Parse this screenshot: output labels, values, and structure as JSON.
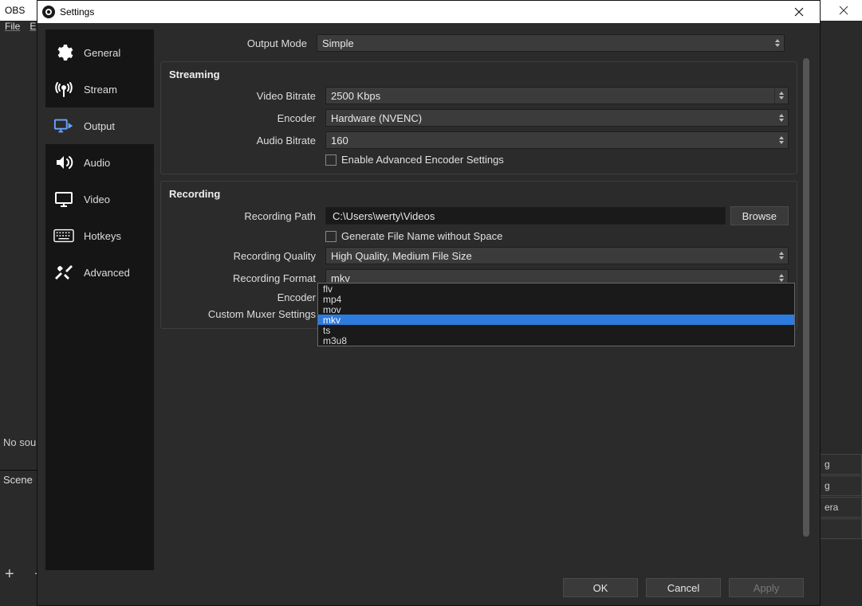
{
  "bg": {
    "title": "OBS",
    "menu": {
      "file": "File",
      "edit": "E"
    },
    "no_sources": "No sourc",
    "scene": "Scene",
    "plusminus": "+  −",
    "rt_rows": [
      "g",
      "g",
      "era",
      ""
    ]
  },
  "dialog": {
    "title": "Settings",
    "sidebar": [
      {
        "key": "general",
        "label": "General"
      },
      {
        "key": "stream",
        "label": "Stream"
      },
      {
        "key": "output",
        "label": "Output",
        "selected": true
      },
      {
        "key": "audio",
        "label": "Audio"
      },
      {
        "key": "video",
        "label": "Video"
      },
      {
        "key": "hotkeys",
        "label": "Hotkeys"
      },
      {
        "key": "advanced",
        "label": "Advanced"
      }
    ],
    "output_mode": {
      "label": "Output Mode",
      "value": "Simple"
    },
    "streaming": {
      "header": "Streaming",
      "video_bitrate": {
        "label": "Video Bitrate",
        "value": "2500 Kbps"
      },
      "encoder": {
        "label": "Encoder",
        "value": "Hardware (NVENC)"
      },
      "audio_bitrate": {
        "label": "Audio Bitrate",
        "value": "160"
      },
      "adv_check": {
        "label": "Enable Advanced Encoder Settings"
      }
    },
    "recording": {
      "header": "Recording",
      "path": {
        "label": "Recording Path",
        "value": "C:\\Users\\werty\\Videos",
        "browse": "Browse"
      },
      "gen_no_space": {
        "label": "Generate File Name without Space"
      },
      "quality": {
        "label": "Recording Quality",
        "value": "High Quality, Medium File Size"
      },
      "format": {
        "label": "Recording Format",
        "value": "mkv"
      },
      "encoder": {
        "label": "Encoder"
      },
      "muxer": {
        "label": "Custom Muxer Settings"
      },
      "dropdown": [
        "flv",
        "mp4",
        "mov",
        "mkv",
        "ts",
        "m3u8"
      ],
      "dropdown_selected": "mkv"
    },
    "buttons": {
      "ok": "OK",
      "cancel": "Cancel",
      "apply": "Apply"
    }
  }
}
